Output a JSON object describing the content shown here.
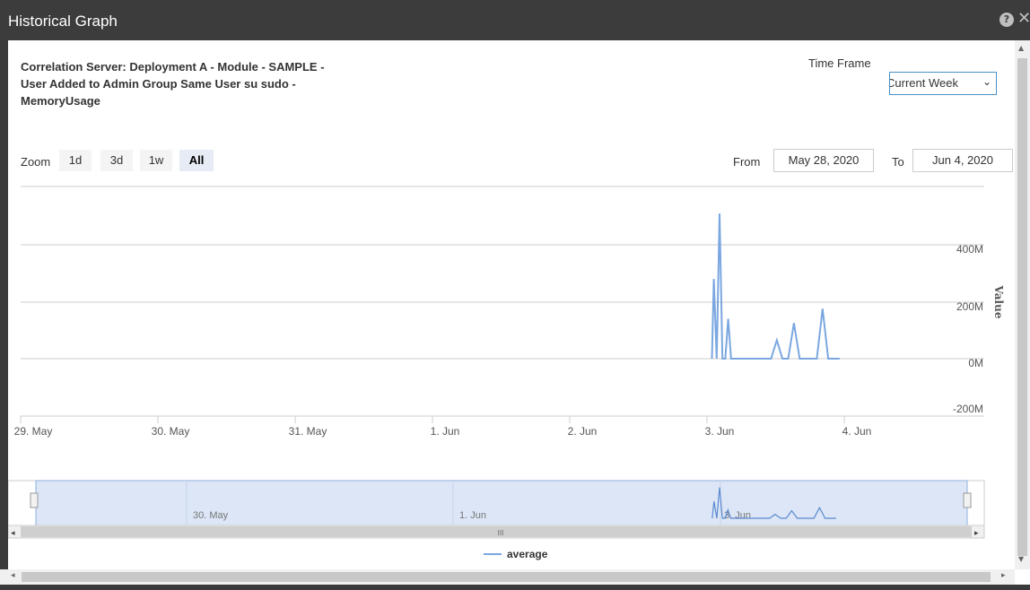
{
  "window": {
    "title": "Historical Graph"
  },
  "heading": "Correlation Server: Deployment A - Module - SAMPLE - User Added to Admin Group Same User su sudo - MemoryUsage",
  "time_frame": {
    "label": "Time Frame",
    "selected": "Current Week"
  },
  "zoom": {
    "label": "Zoom",
    "options": [
      "1d",
      "3d",
      "1w",
      "All"
    ],
    "active": "All"
  },
  "range": {
    "from_label": "From",
    "from_value": "May 28, 2020",
    "to_label": "To",
    "to_value": "Jun 4, 2020"
  },
  "navigator": {
    "scrollbar_grip": "III"
  },
  "colors": {
    "series": "#7ba7e0",
    "navigator_fill": "#dce6f6",
    "titlebar": "#3c3c3c"
  },
  "chart_data": {
    "type": "line",
    "ylabel": "Value",
    "y_ticks": [
      "-200M",
      "0M",
      "200M",
      "400M"
    ],
    "ylim": [
      -200,
      600
    ],
    "x_ticks": [
      "29. May",
      "30. May",
      "31. May",
      "1. Jun",
      "2. Jun",
      "3. Jun",
      "4. Jun"
    ],
    "navigator_ticks": [
      "30. May",
      "1. Jun",
      "3. Jun"
    ],
    "legend": "average",
    "series": [
      {
        "name": "average",
        "x": [
          "2020-06-02T22:40",
          "2020-06-02T23:00",
          "2020-06-02T23:30",
          "2020-06-03T00:00",
          "2020-06-03T00:30",
          "2020-06-03T01:00",
          "2020-06-03T01:30",
          "2020-06-03T02:00",
          "2020-06-03T03:00",
          "2020-06-03T06:00",
          "2020-06-03T09:00",
          "2020-06-03T10:00",
          "2020-06-03T11:00",
          "2020-06-03T12:00",
          "2020-06-03T13:00",
          "2020-06-03T14:00",
          "2020-06-03T16:00",
          "2020-06-03T17:00",
          "2020-06-03T18:00",
          "2020-06-03T19:00",
          "2020-06-03T20:00",
          "2020-06-03T21:00"
        ],
        "values": [
          0,
          280,
          0,
          510,
          0,
          0,
          140,
          0,
          0,
          0,
          0,
          65,
          0,
          0,
          125,
          0,
          0,
          0,
          175,
          0,
          0,
          0
        ]
      }
    ]
  }
}
